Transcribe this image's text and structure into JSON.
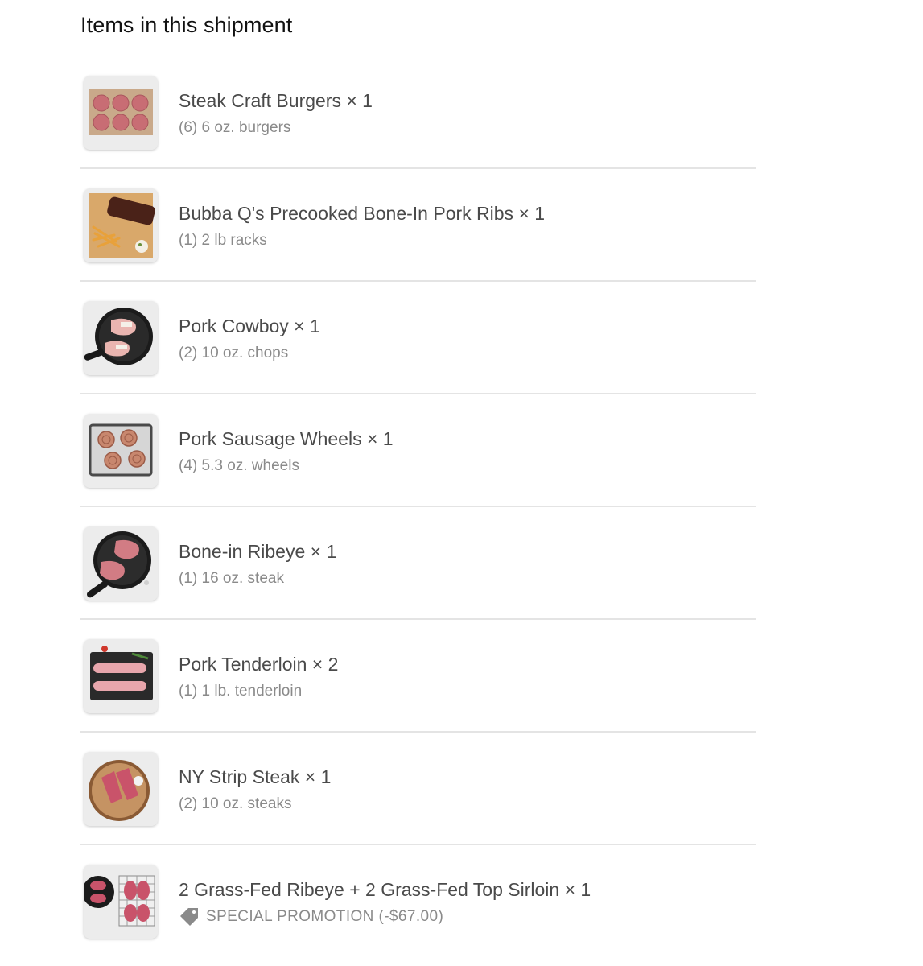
{
  "page_title": "Items in this shipment",
  "items": [
    {
      "name": "Steak Craft Burgers × 1",
      "detail": "(6) 6 oz. burgers",
      "icon": "burger-patties-thumbnail"
    },
    {
      "name": "Bubba Q's Precooked Bone-In Pork Ribs × 1",
      "detail": "(1) 2 lb racks",
      "icon": "pork-ribs-thumbnail"
    },
    {
      "name": "Pork Cowboy × 1",
      "detail": "(2) 10 oz. chops",
      "icon": "pork-chops-skillet-thumbnail"
    },
    {
      "name": "Pork Sausage Wheels × 1",
      "detail": "(4) 5.3 oz. wheels",
      "icon": "sausage-wheels-thumbnail"
    },
    {
      "name": "Bone-in Ribeye × 1",
      "detail": "(1) 16 oz. steak",
      "icon": "ribeye-skillet-thumbnail"
    },
    {
      "name": "Pork Tenderloin × 2",
      "detail": "(1) 1 lb. tenderloin",
      "icon": "pork-tenderloin-thumbnail"
    },
    {
      "name": "NY Strip Steak × 1",
      "detail": "(2) 10 oz. steaks",
      "icon": "strip-steak-board-thumbnail"
    },
    {
      "name": "2 Grass-Fed Ribeye + 2 Grass-Fed Top Sirloin × 1",
      "promo": "SPECIAL PROMOTION (-$67.00)",
      "icon": "steak-bundle-thumbnail",
      "promo_icon": "price-tag-icon"
    }
  ]
}
